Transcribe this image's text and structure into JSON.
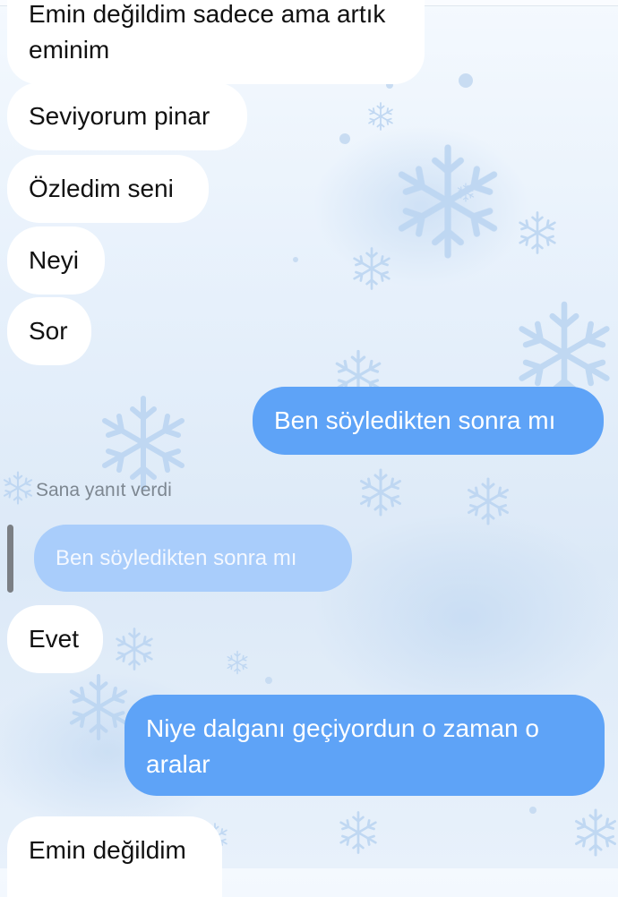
{
  "messages": [
    {
      "id": "m1",
      "direction": "incoming",
      "text": "Emin değildim sadece ama artık eminim"
    },
    {
      "id": "m2",
      "direction": "incoming",
      "text": "Seviyorum pinar"
    },
    {
      "id": "m3",
      "direction": "incoming",
      "text": "Özledim seni"
    },
    {
      "id": "m4",
      "direction": "incoming",
      "text": "Neyi"
    },
    {
      "id": "m5",
      "direction": "incoming",
      "text": "Sor"
    },
    {
      "id": "m6",
      "direction": "outgoing",
      "text": "Ben söyledikten sonra mı"
    },
    {
      "id": "m7",
      "direction": "incoming",
      "reply_label": "Sana yanıt verdi",
      "quoted_text": "Ben söyledikten sonra mı",
      "text": "Evet"
    },
    {
      "id": "m8",
      "direction": "outgoing",
      "text": "Niye dalganı geçiyordun o zaman o aralar"
    },
    {
      "id": "m9",
      "direction": "incoming",
      "text": "Emin değildim"
    }
  ],
  "theme": {
    "background": "winter-snowflakes",
    "outgoing_color": "#5ea3f7",
    "incoming_color": "#ffffff",
    "quote_color": "#a9cdfb"
  }
}
